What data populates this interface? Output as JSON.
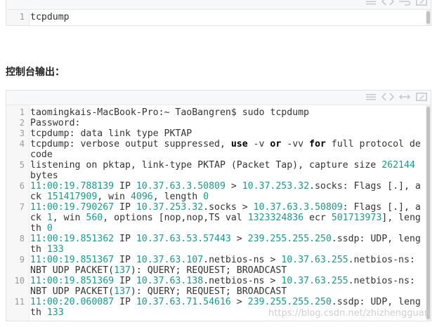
{
  "block1": {
    "lines": [
      {
        "n": "1",
        "segs": [
          {
            "t": "tcpdump",
            "c": ""
          }
        ]
      }
    ]
  },
  "heading": "控制台输出：",
  "block2": {
    "lines": [
      {
        "n": "1",
        "segs": [
          {
            "t": "taomingkais-MacBook-Pro:~ TaoBangren$ sudo tcpdump",
            "c": ""
          }
        ]
      },
      {
        "n": "2",
        "segs": [
          {
            "t": "Password:",
            "c": ""
          }
        ]
      },
      {
        "n": "3",
        "segs": [
          {
            "t": "tcpdump: data link type PKTAP",
            "c": ""
          }
        ]
      },
      {
        "n": "4",
        "segs": [
          {
            "t": "tcpdump: verbose output suppressed, ",
            "c": ""
          },
          {
            "t": "use",
            "c": "kw"
          },
          {
            "t": " -v ",
            "c": ""
          },
          {
            "t": "or",
            "c": "kw"
          },
          {
            "t": " -vv ",
            "c": ""
          },
          {
            "t": "for",
            "c": "kw"
          },
          {
            "t": " full protocol decode",
            "c": ""
          }
        ]
      },
      {
        "n": "5",
        "segs": [
          {
            "t": "listening on pktap, link-type PKTAP (Packet Tap), capture size ",
            "c": ""
          },
          {
            "t": "262144",
            "c": "num"
          },
          {
            "t": " bytes",
            "c": ""
          }
        ]
      },
      {
        "n": "6",
        "segs": [
          {
            "t": "11:00:19.788139",
            "c": "num"
          },
          {
            "t": " IP ",
            "c": ""
          },
          {
            "t": "10.37.63.3.50809",
            "c": "num"
          },
          {
            "t": " > ",
            "c": ""
          },
          {
            "t": "10.37.253.32",
            "c": "num"
          },
          {
            "t": ".socks: Flags [.], ack ",
            "c": ""
          },
          {
            "t": "151417909",
            "c": "num"
          },
          {
            "t": ", win ",
            "c": ""
          },
          {
            "t": "4096",
            "c": "num"
          },
          {
            "t": ", length ",
            "c": ""
          },
          {
            "t": "0",
            "c": "num"
          }
        ]
      },
      {
        "n": "7",
        "segs": [
          {
            "t": "11:00:19.790267",
            "c": "num"
          },
          {
            "t": " IP ",
            "c": ""
          },
          {
            "t": "10.37.253.32",
            "c": "num"
          },
          {
            "t": ".socks > ",
            "c": ""
          },
          {
            "t": "10.37.63.3.50809",
            "c": "num"
          },
          {
            "t": ": Flags [.], ack ",
            "c": ""
          },
          {
            "t": "1",
            "c": "num"
          },
          {
            "t": ", win ",
            "c": ""
          },
          {
            "t": "560",
            "c": "num"
          },
          {
            "t": ", options [nop,nop,TS val ",
            "c": ""
          },
          {
            "t": "1323324836",
            "c": "num"
          },
          {
            "t": " ecr ",
            "c": ""
          },
          {
            "t": "501713973",
            "c": "num"
          },
          {
            "t": "], length ",
            "c": ""
          },
          {
            "t": "0",
            "c": "num"
          }
        ]
      },
      {
        "n": "8",
        "segs": [
          {
            "t": "11:00:19.851362",
            "c": "num"
          },
          {
            "t": " IP ",
            "c": ""
          },
          {
            "t": "10.37.63.53.57443",
            "c": "num"
          },
          {
            "t": " > ",
            "c": ""
          },
          {
            "t": "239.255.255.250",
            "c": "num"
          },
          {
            "t": ".ssdp: UDP, length ",
            "c": ""
          },
          {
            "t": "133",
            "c": "num"
          }
        ]
      },
      {
        "n": "9",
        "segs": [
          {
            "t": "11:00:19.851367",
            "c": "num"
          },
          {
            "t": " IP ",
            "c": ""
          },
          {
            "t": "10.37.63.107",
            "c": "num"
          },
          {
            "t": ".netbios-ns > ",
            "c": ""
          },
          {
            "t": "10.37.63.255",
            "c": "num"
          },
          {
            "t": ".netbios-ns: NBT UDP PACKET(",
            "c": ""
          },
          {
            "t": "137",
            "c": "num"
          },
          {
            "t": "): QUERY; REQUEST; BROADCAST",
            "c": ""
          }
        ]
      },
      {
        "n": "10",
        "segs": [
          {
            "t": "11:00:19.851369",
            "c": "num"
          },
          {
            "t": " IP ",
            "c": ""
          },
          {
            "t": "10.37.63.138",
            "c": "num"
          },
          {
            "t": ".netbios-ns > ",
            "c": ""
          },
          {
            "t": "10.37.63.255",
            "c": "num"
          },
          {
            "t": ".netbios-ns: NBT UDP PACKET(",
            "c": ""
          },
          {
            "t": "137",
            "c": "num"
          },
          {
            "t": "): QUERY; REQUEST; BROADCAST",
            "c": ""
          }
        ]
      },
      {
        "n": "11",
        "segs": [
          {
            "t": "11:00:20.060087",
            "c": "num"
          },
          {
            "t": " IP ",
            "c": ""
          },
          {
            "t": "10.37.63.71.54616",
            "c": "num"
          },
          {
            "t": " > ",
            "c": ""
          },
          {
            "t": "239.255.255.250",
            "c": "num"
          },
          {
            "t": ".ssdp: UDP, length ",
            "c": ""
          },
          {
            "t": "133",
            "c": "num"
          }
        ]
      }
    ]
  },
  "watermark": "https://blog.csdn.net/zhizhengguan",
  "toolbar_icons": [
    "menu-icon",
    "code-icon",
    "wrap-icon",
    "expand-icon"
  ]
}
